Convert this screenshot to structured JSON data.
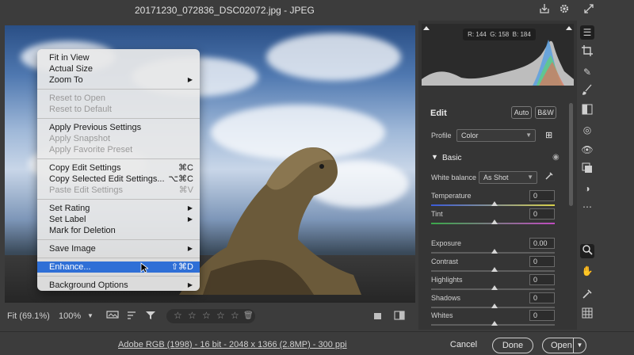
{
  "window": {
    "title": "20171230_072836_DSC02072.jpg  -  JPEG"
  },
  "context_menu": {
    "items": [
      {
        "label": "Fit in View",
        "disabled": false
      },
      {
        "label": "Actual Size",
        "disabled": false
      },
      {
        "label": "Zoom To",
        "disabled": false,
        "submenu": true
      },
      {
        "label": "Reset to Open",
        "disabled": true
      },
      {
        "label": "Reset to Default",
        "disabled": true
      },
      {
        "label": "Apply Previous Settings",
        "disabled": false
      },
      {
        "label": "Apply Snapshot",
        "disabled": true
      },
      {
        "label": "Apply Favorite Preset",
        "disabled": true
      },
      {
        "label": "Copy Edit Settings",
        "shortcut": "⌘C",
        "disabled": false
      },
      {
        "label": "Copy Selected Edit Settings...",
        "shortcut": "⌥⌘C",
        "disabled": false
      },
      {
        "label": "Paste Edit Settings",
        "shortcut": "⌘V",
        "disabled": true
      },
      {
        "label": "Set Rating",
        "disabled": false,
        "submenu": true
      },
      {
        "label": "Set Label",
        "disabled": false,
        "submenu": true
      },
      {
        "label": "Mark for Deletion",
        "disabled": false
      },
      {
        "label": "Save Image",
        "disabled": false,
        "submenu": true
      },
      {
        "label": "Enhance...",
        "shortcut": "⇧⌘D",
        "disabled": false,
        "selected": true
      },
      {
        "label": "Background Options",
        "disabled": false,
        "submenu": true
      }
    ]
  },
  "bottom_toolbar": {
    "fit_label": "Fit (69.1%)",
    "zoom_label": "100%"
  },
  "histogram": {
    "r_label": "R: 144",
    "g_label": "G: 158",
    "b_label": "B: 184"
  },
  "edit_panel": {
    "title": "Edit",
    "auto_label": "Auto",
    "bw_label": "B&W",
    "profile_label": "Profile",
    "profile_value": "Color",
    "basic_label": "Basic",
    "white_balance_label": "White balance",
    "white_balance_value": "As Shot",
    "sliders": [
      {
        "label": "Temperature",
        "value": "0"
      },
      {
        "label": "Tint",
        "value": "0"
      },
      {
        "label": "Exposure",
        "value": "0.00"
      },
      {
        "label": "Contrast",
        "value": "0"
      },
      {
        "label": "Highlights",
        "value": "0"
      },
      {
        "label": "Shadows",
        "value": "0"
      },
      {
        "label": "Whites",
        "value": "0"
      }
    ]
  },
  "footer": {
    "file_info": "Adobe RGB (1998) - 16 bit - 2048 x 1366 (2.8MP) - 300 ppi",
    "cancel_label": "Cancel",
    "done_label": "Done",
    "open_label": "Open"
  },
  "colors": {
    "accent": "#2f6fd6",
    "panel_bg": "#353535",
    "app_bg": "#3c3c3c"
  }
}
